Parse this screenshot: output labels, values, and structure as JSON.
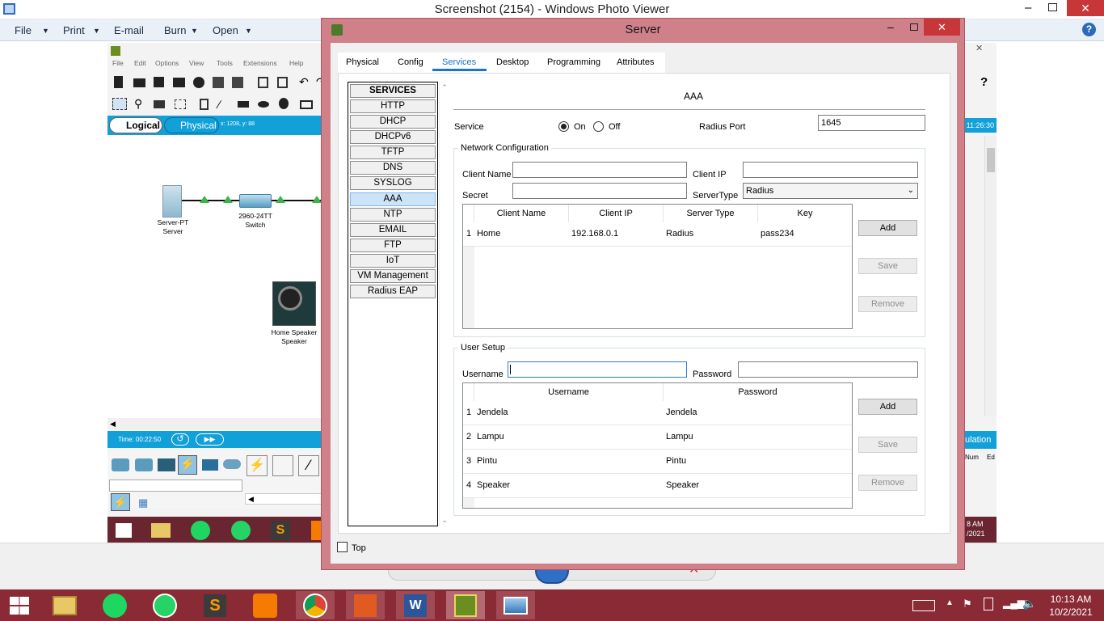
{
  "photo_viewer": {
    "title": "Screenshot (2154) - Windows Photo Viewer",
    "menu": [
      {
        "label": "File"
      },
      {
        "label": "Print"
      },
      {
        "label": "E-mail"
      },
      {
        "label": "Burn"
      },
      {
        "label": "Open"
      }
    ]
  },
  "packet_tracer": {
    "menu": [
      "File",
      "Edit",
      "Options",
      "View",
      "Tools",
      "Extensions",
      "Help"
    ],
    "mode_logical": "Logical",
    "mode_physical": "Physical",
    "coords": "x: 1208, y: 88",
    "devices": [
      {
        "name": "Server-PT",
        "sub": "Server"
      },
      {
        "name": "2960-24TT",
        "sub": "Switch"
      },
      {
        "name": "Home Speaker",
        "sub": "Speaker"
      }
    ],
    "time_label": "Time: 00:22:50",
    "clock": "11:26:30",
    "right_label": "ulation",
    "num_label": "Num",
    "ed_label": "Ed",
    "mini_time": "8 AM",
    "mini_date": "/2021"
  },
  "server_window": {
    "title": "Server",
    "tabs": [
      "Physical",
      "Config",
      "Services",
      "Desktop",
      "Programming",
      "Attributes"
    ],
    "active_tab": "Services",
    "services_header": "SERVICES",
    "services": [
      "HTTP",
      "DHCP",
      "DHCPv6",
      "TFTP",
      "DNS",
      "SYSLOG",
      "AAA",
      "NTP",
      "EMAIL",
      "FTP",
      "IoT",
      "VM Management",
      "Radius EAP"
    ],
    "selected_service": "AAA",
    "section_title": "AAA",
    "service_label": "Service",
    "on_label": "On",
    "off_label": "Off",
    "service_on": true,
    "radius_port_label": "Radius Port",
    "radius_port": "1645",
    "netconf": {
      "title": "Network Configuration",
      "client_name_label": "Client Name",
      "client_name": "",
      "client_ip_label": "Client IP",
      "client_ip": "",
      "secret_label": "Secret",
      "secret": "",
      "server_type_label": "ServerType",
      "server_type": "Radius",
      "columns": [
        "Client Name",
        "Client IP",
        "Server Type",
        "Key"
      ],
      "rows": [
        {
          "n": "1",
          "name": "Home",
          "ip": "192.168.0.1",
          "type": "Radius",
          "key": "pass234"
        }
      ],
      "add": "Add",
      "save": "Save",
      "remove": "Remove"
    },
    "user_setup": {
      "title": "User Setup",
      "username_label": "Username",
      "username": "",
      "password_label": "Password",
      "password": "",
      "columns": [
        "Username",
        "Password"
      ],
      "rows": [
        {
          "n": "1",
          "user": "Jendela",
          "pass": "Jendela"
        },
        {
          "n": "2",
          "user": "Lampu",
          "pass": "Lampu"
        },
        {
          "n": "3",
          "user": "Pintu",
          "pass": "Pintu"
        },
        {
          "n": "4",
          "user": "Speaker",
          "pass": "Speaker"
        }
      ],
      "add": "Add",
      "save": "Save",
      "remove": "Remove"
    },
    "top_label": "Top"
  },
  "taskbar": {
    "time": "10:13 AM",
    "date": "10/2/2021"
  }
}
